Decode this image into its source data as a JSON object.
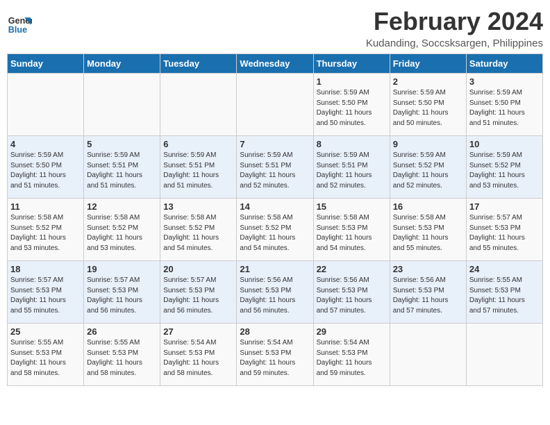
{
  "logo": {
    "line1": "General",
    "line2": "Blue"
  },
  "title": "February 2024",
  "location": "Kudanding, Soccsksargen, Philippines",
  "weekdays": [
    "Sunday",
    "Monday",
    "Tuesday",
    "Wednesday",
    "Thursday",
    "Friday",
    "Saturday"
  ],
  "weeks": [
    [
      {
        "day": "",
        "info": ""
      },
      {
        "day": "",
        "info": ""
      },
      {
        "day": "",
        "info": ""
      },
      {
        "day": "",
        "info": ""
      },
      {
        "day": "1",
        "info": "Sunrise: 5:59 AM\nSunset: 5:50 PM\nDaylight: 11 hours\nand 50 minutes."
      },
      {
        "day": "2",
        "info": "Sunrise: 5:59 AM\nSunset: 5:50 PM\nDaylight: 11 hours\nand 50 minutes."
      },
      {
        "day": "3",
        "info": "Sunrise: 5:59 AM\nSunset: 5:50 PM\nDaylight: 11 hours\nand 51 minutes."
      }
    ],
    [
      {
        "day": "4",
        "info": "Sunrise: 5:59 AM\nSunset: 5:50 PM\nDaylight: 11 hours\nand 51 minutes."
      },
      {
        "day": "5",
        "info": "Sunrise: 5:59 AM\nSunset: 5:51 PM\nDaylight: 11 hours\nand 51 minutes."
      },
      {
        "day": "6",
        "info": "Sunrise: 5:59 AM\nSunset: 5:51 PM\nDaylight: 11 hours\nand 51 minutes."
      },
      {
        "day": "7",
        "info": "Sunrise: 5:59 AM\nSunset: 5:51 PM\nDaylight: 11 hours\nand 52 minutes."
      },
      {
        "day": "8",
        "info": "Sunrise: 5:59 AM\nSunset: 5:51 PM\nDaylight: 11 hours\nand 52 minutes."
      },
      {
        "day": "9",
        "info": "Sunrise: 5:59 AM\nSunset: 5:52 PM\nDaylight: 11 hours\nand 52 minutes."
      },
      {
        "day": "10",
        "info": "Sunrise: 5:59 AM\nSunset: 5:52 PM\nDaylight: 11 hours\nand 53 minutes."
      }
    ],
    [
      {
        "day": "11",
        "info": "Sunrise: 5:58 AM\nSunset: 5:52 PM\nDaylight: 11 hours\nand 53 minutes."
      },
      {
        "day": "12",
        "info": "Sunrise: 5:58 AM\nSunset: 5:52 PM\nDaylight: 11 hours\nand 53 minutes."
      },
      {
        "day": "13",
        "info": "Sunrise: 5:58 AM\nSunset: 5:52 PM\nDaylight: 11 hours\nand 54 minutes."
      },
      {
        "day": "14",
        "info": "Sunrise: 5:58 AM\nSunset: 5:52 PM\nDaylight: 11 hours\nand 54 minutes."
      },
      {
        "day": "15",
        "info": "Sunrise: 5:58 AM\nSunset: 5:53 PM\nDaylight: 11 hours\nand 54 minutes."
      },
      {
        "day": "16",
        "info": "Sunrise: 5:58 AM\nSunset: 5:53 PM\nDaylight: 11 hours\nand 55 minutes."
      },
      {
        "day": "17",
        "info": "Sunrise: 5:57 AM\nSunset: 5:53 PM\nDaylight: 11 hours\nand 55 minutes."
      }
    ],
    [
      {
        "day": "18",
        "info": "Sunrise: 5:57 AM\nSunset: 5:53 PM\nDaylight: 11 hours\nand 55 minutes."
      },
      {
        "day": "19",
        "info": "Sunrise: 5:57 AM\nSunset: 5:53 PM\nDaylight: 11 hours\nand 56 minutes."
      },
      {
        "day": "20",
        "info": "Sunrise: 5:57 AM\nSunset: 5:53 PM\nDaylight: 11 hours\nand 56 minutes."
      },
      {
        "day": "21",
        "info": "Sunrise: 5:56 AM\nSunset: 5:53 PM\nDaylight: 11 hours\nand 56 minutes."
      },
      {
        "day": "22",
        "info": "Sunrise: 5:56 AM\nSunset: 5:53 PM\nDaylight: 11 hours\nand 57 minutes."
      },
      {
        "day": "23",
        "info": "Sunrise: 5:56 AM\nSunset: 5:53 PM\nDaylight: 11 hours\nand 57 minutes."
      },
      {
        "day": "24",
        "info": "Sunrise: 5:55 AM\nSunset: 5:53 PM\nDaylight: 11 hours\nand 57 minutes."
      }
    ],
    [
      {
        "day": "25",
        "info": "Sunrise: 5:55 AM\nSunset: 5:53 PM\nDaylight: 11 hours\nand 58 minutes."
      },
      {
        "day": "26",
        "info": "Sunrise: 5:55 AM\nSunset: 5:53 PM\nDaylight: 11 hours\nand 58 minutes."
      },
      {
        "day": "27",
        "info": "Sunrise: 5:54 AM\nSunset: 5:53 PM\nDaylight: 11 hours\nand 58 minutes."
      },
      {
        "day": "28",
        "info": "Sunrise: 5:54 AM\nSunset: 5:53 PM\nDaylight: 11 hours\nand 59 minutes."
      },
      {
        "day": "29",
        "info": "Sunrise: 5:54 AM\nSunset: 5:53 PM\nDaylight: 11 hours\nand 59 minutes."
      },
      {
        "day": "",
        "info": ""
      },
      {
        "day": "",
        "info": ""
      }
    ]
  ]
}
